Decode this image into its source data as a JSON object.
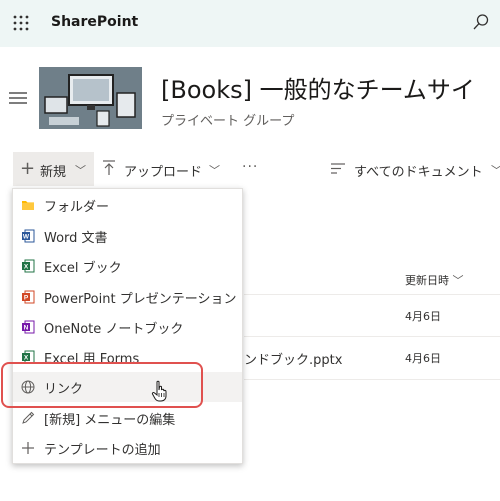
{
  "app": {
    "name": "SharePoint"
  },
  "site": {
    "title": "[Books] 一般的なチームサイ",
    "subtitle": "プライベート グループ"
  },
  "command_bar": {
    "new_label": "新規",
    "upload_label": "アップロード",
    "more_label": "···",
    "view_label": "すべてのドキュメント"
  },
  "list": {
    "column_modified": "更新日時",
    "rows": [
      {
        "name": "",
        "modified": "4月6日"
      },
      {
        "name": "ンドブック.pptx",
        "modified": "4月6日"
      }
    ]
  },
  "new_menu": {
    "items": [
      {
        "label": "フォルダー",
        "icon": "folder-icon"
      },
      {
        "label": "Word 文書",
        "icon": "word-icon"
      },
      {
        "label": "Excel ブック",
        "icon": "excel-icon"
      },
      {
        "label": "PowerPoint プレゼンテーション",
        "icon": "powerpoint-icon"
      },
      {
        "label": "OneNote ノートブック",
        "icon": "onenote-icon"
      },
      {
        "label": "Excel 用 Forms",
        "icon": "forms-icon"
      },
      {
        "label": "リンク",
        "icon": "globe-icon",
        "hovered": true
      },
      {
        "label": "[新規] メニューの編集",
        "icon": "pencil-icon"
      },
      {
        "label": "テンプレートの追加",
        "icon": "plus-icon"
      }
    ]
  },
  "colors": {
    "suite_bar": "#eef6f5",
    "highlight": "#e0514f",
    "word": "#2b579a",
    "excel": "#217346",
    "powerpoint": "#d24726",
    "onenote": "#7719aa",
    "folder": "#ffb900"
  }
}
